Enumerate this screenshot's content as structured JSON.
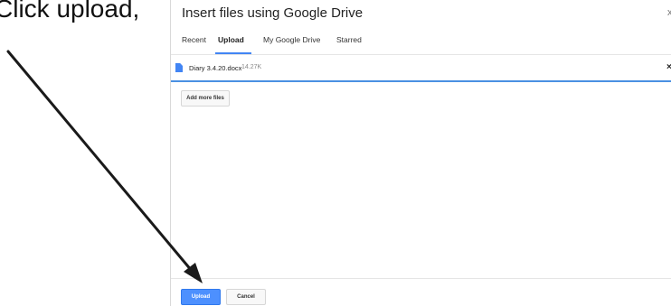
{
  "instruction": {
    "text": "Click upload,"
  },
  "dialog": {
    "title": "Insert files using Google Drive",
    "close_glyph": "x",
    "tabs": [
      {
        "label": "Recent",
        "active": false
      },
      {
        "label": "Upload",
        "active": true
      },
      {
        "label": "My Google Drive",
        "active": false
      },
      {
        "label": "Starred",
        "active": false
      }
    ],
    "file": {
      "icon": "doc-file-icon",
      "name": "Diary 3.4.20.docx",
      "size": "14.27K",
      "remove_glyph": "×"
    },
    "add_more_label": "Add more files",
    "upload_label": "Upload",
    "cancel_label": "Cancel"
  },
  "colors": {
    "accent": "#4285f4",
    "upload_button": "#4d90fe",
    "progress": "#4a90e2"
  }
}
